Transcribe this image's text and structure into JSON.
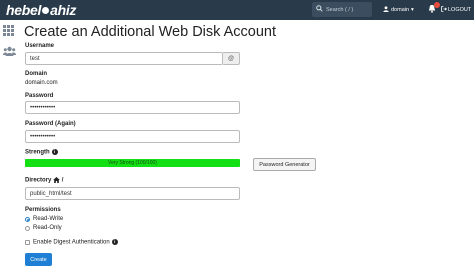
{
  "topbar": {
    "brand_left": "hebel",
    "brand_right": "ahiz",
    "search_placeholder": "Search ( / )",
    "user_label": "domain",
    "logout_label": "LOGOUT"
  },
  "page": {
    "title": "Create an Additional Web Disk Account"
  },
  "form": {
    "username_label": "Username",
    "username_value": "test",
    "username_addon": "@",
    "domain_label": "Domain",
    "domain_value": "domain.com",
    "password_label": "Password",
    "password_value": "••••••••••••",
    "password_again_label": "Password (Again)",
    "password_again_value": "••••••••••••",
    "strength_label": "Strength",
    "strength_value": "Very Strong (100/100)",
    "strength_level": 1.0,
    "password_generator_label": "Password Generator",
    "directory_label": "Directory",
    "directory_suffix": "/",
    "directory_value": "public_html/test",
    "permissions_label": "Permissions",
    "permission_options": [
      "Read-Write",
      "Read-Only"
    ],
    "permission_selected": "Read-Write",
    "digest_label": "Enable Digest Authentication",
    "create_label": "Create"
  },
  "colors": {
    "topbar": "#293a4a",
    "strength": "#12e012",
    "primary_button": "#1f7fd4"
  },
  "icons": [
    "search-icon",
    "user-icon",
    "bell-icon",
    "logout-icon",
    "apps-grid-icon",
    "users-icon",
    "home-icon",
    "info-icon"
  ]
}
